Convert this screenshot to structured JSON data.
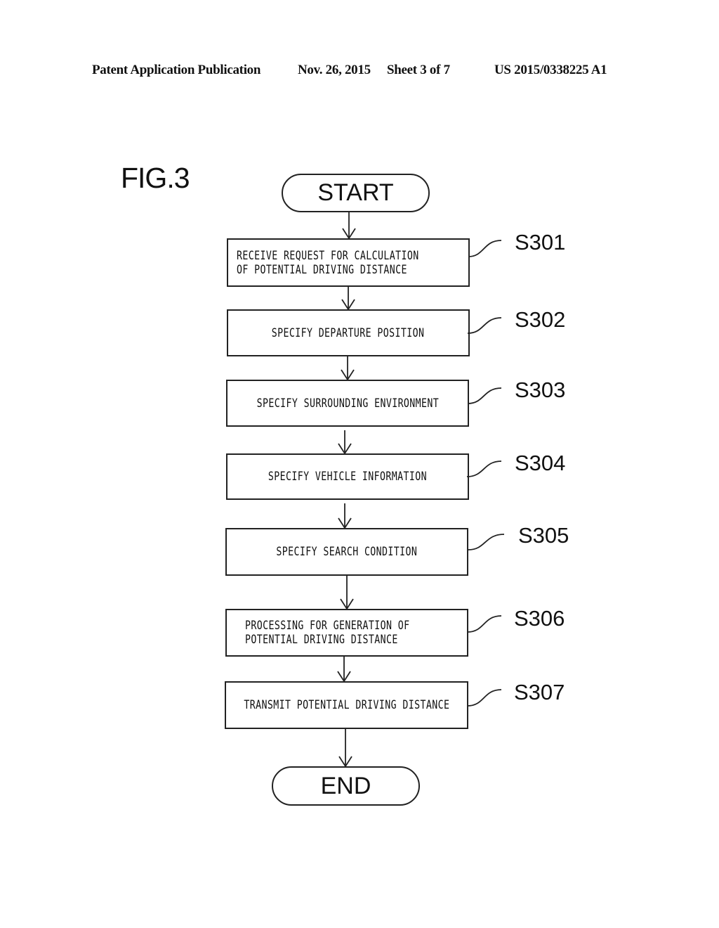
{
  "header": {
    "publication": "Patent Application Publication",
    "date": "Nov. 26, 2015",
    "sheet": "Sheet 3 of 7",
    "number": "US 2015/0338225 A1"
  },
  "figure": {
    "label": "FIG.3",
    "start": "START",
    "end": "END",
    "steps": [
      {
        "id": "S301",
        "lines": [
          "RECEIVE REQUEST FOR CALCULATION",
          "OF POTENTIAL DRIVING DISTANCE"
        ]
      },
      {
        "id": "S302",
        "lines": [
          "SPECIFY DEPARTURE POSITION"
        ]
      },
      {
        "id": "S303",
        "lines": [
          "SPECIFY SURROUNDING ENVIRONMENT"
        ]
      },
      {
        "id": "S304",
        "lines": [
          "SPECIFY VEHICLE INFORMATION"
        ]
      },
      {
        "id": "S305",
        "lines": [
          "SPECIFY SEARCH CONDITION"
        ]
      },
      {
        "id": "S306",
        "lines": [
          "PROCESSING FOR GENERATION OF",
          "POTENTIAL DRIVING DISTANCE"
        ]
      },
      {
        "id": "S307",
        "lines": [
          "TRANSMIT POTENTIAL DRIVING DISTANCE"
        ]
      }
    ]
  }
}
